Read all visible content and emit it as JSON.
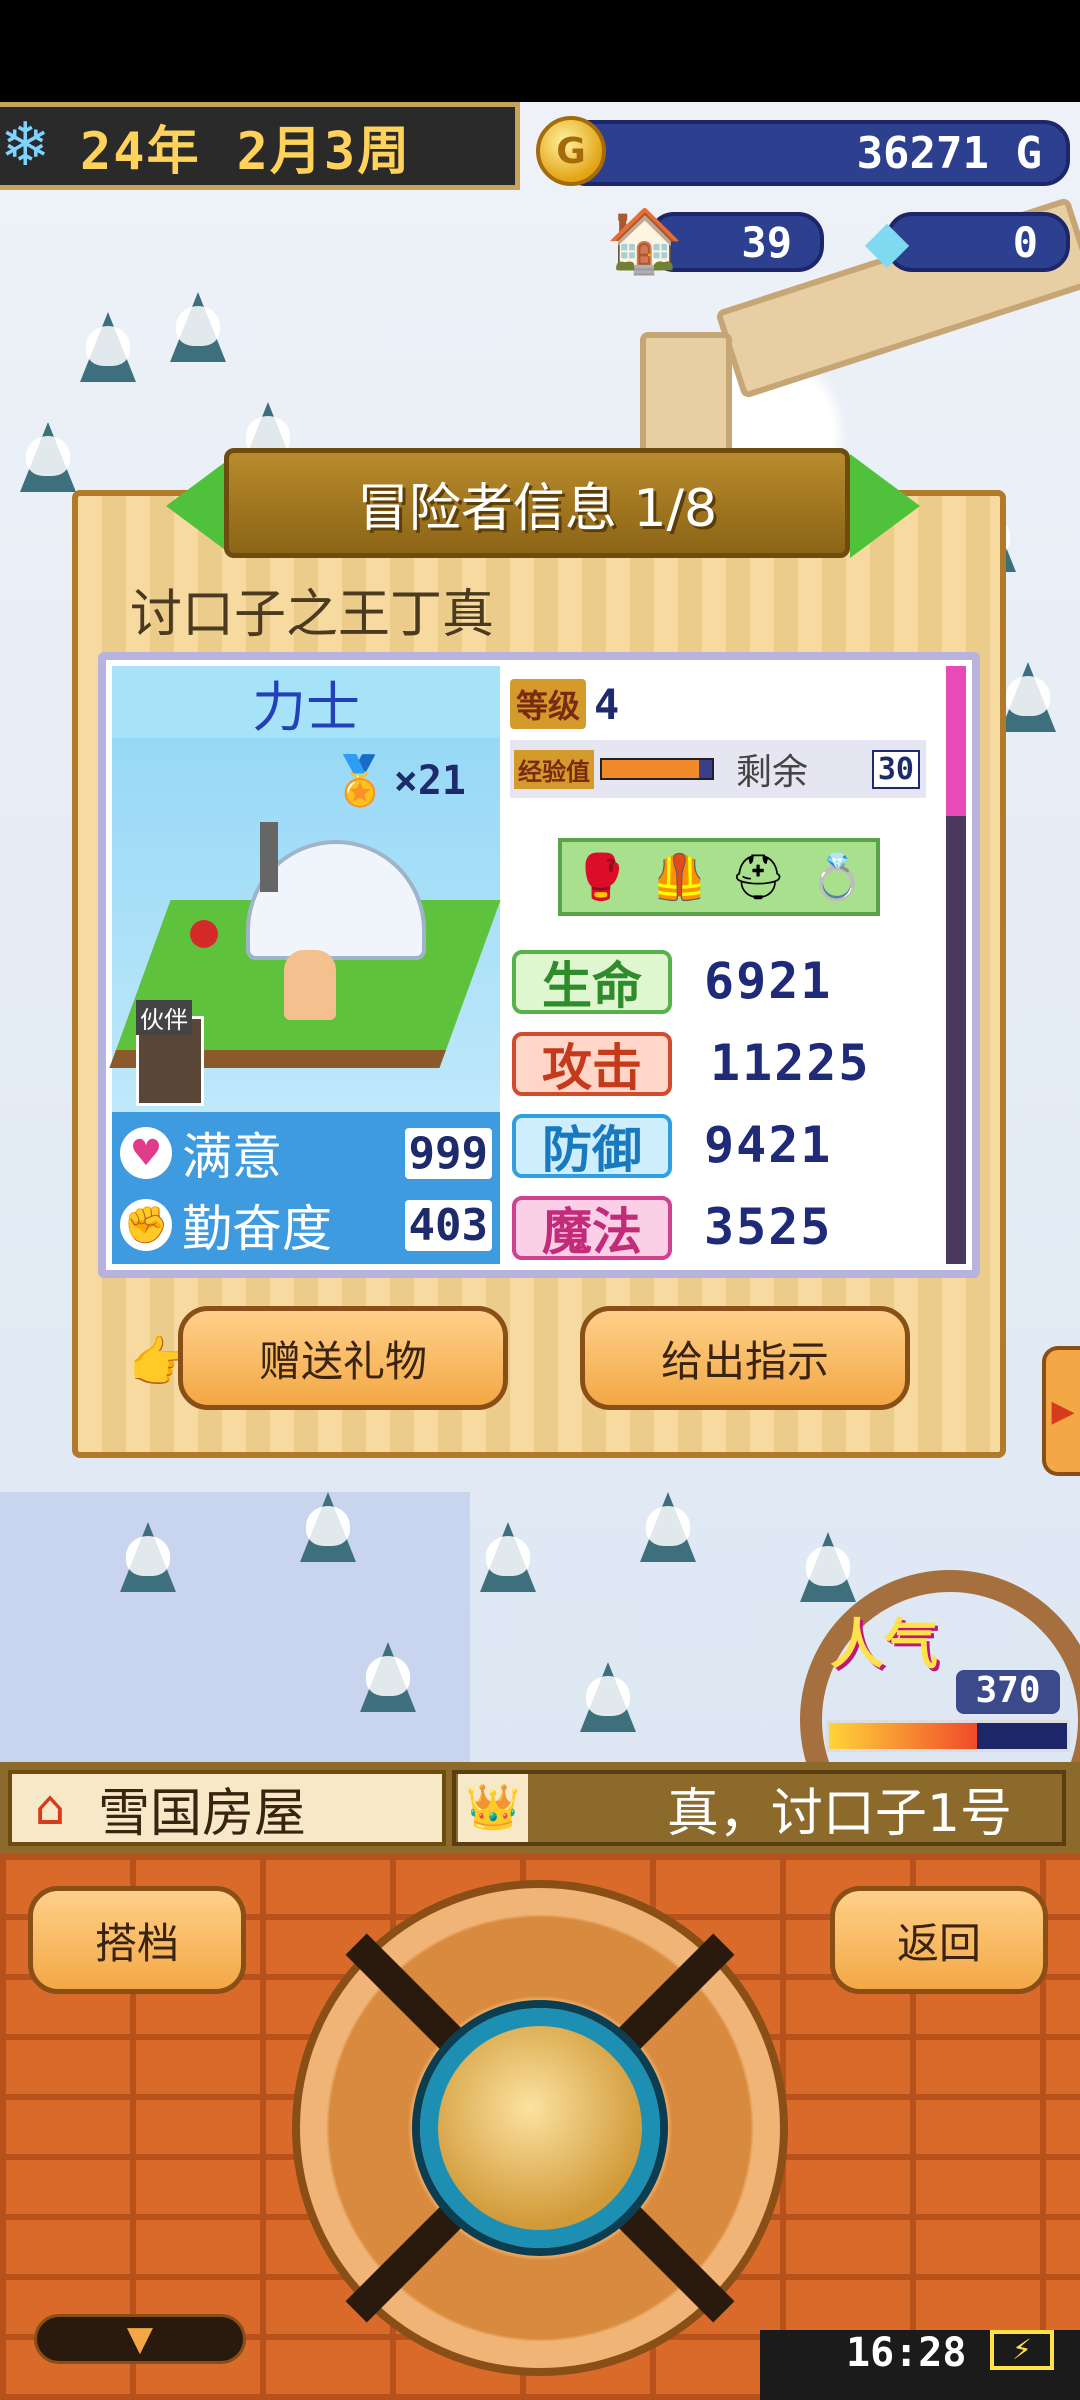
{
  "hud": {
    "year": "24年",
    "month_week": "2月3周",
    "gold": "36271 G",
    "houses": "39",
    "crystals": "0"
  },
  "dialog": {
    "title": "冒险者信息 1/8",
    "adventurer_name": "讨口子之王丁真",
    "class_name": "力士",
    "medal_count": "×21",
    "companion_label": "伙伴",
    "satisfaction_label": "满意",
    "satisfaction_value": "999",
    "diligence_label": "勤奋度",
    "diligence_value": "403",
    "level_label": "等级",
    "level_value": "4",
    "exp_label": "经验值",
    "exp_fill_fraction": 0.88,
    "remaining_label": "剩余",
    "remaining_value": "30",
    "equipment_icons": [
      "glove-icon",
      "armor-icon",
      "helmet-icon",
      "ring-icon"
    ],
    "stats": [
      {
        "label": "生命",
        "value": "6921"
      },
      {
        "label": "攻击",
        "value": "11225"
      },
      {
        "label": "防御",
        "value": "9421"
      },
      {
        "label": "魔法",
        "value": "3525"
      }
    ],
    "gift_button": "赠送礼物",
    "instruct_button": "给出指示"
  },
  "popularity": {
    "label": "人气",
    "value": "370"
  },
  "location_bar": {
    "building": "雪国房屋",
    "occupant": "真，讨口子1号"
  },
  "controls": {
    "partner_button": "搭档",
    "back_button": "返回"
  },
  "status": {
    "time": "16:28"
  }
}
